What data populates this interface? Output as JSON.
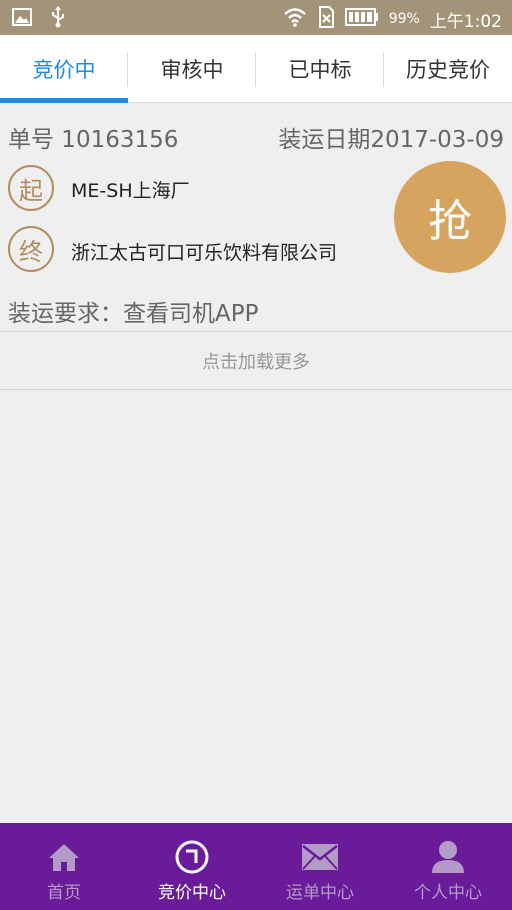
{
  "status": {
    "battery": "99%",
    "time": "上午1:02"
  },
  "tabs": [
    {
      "label": "竞价中"
    },
    {
      "label": "审核中"
    },
    {
      "label": "已中标"
    },
    {
      "label": "历史竞价"
    }
  ],
  "order": {
    "number": "单号 10163156",
    "date": "装运日期2017-03-09",
    "origin_badge": "起",
    "origin": "ME-SH上海厂",
    "dest_badge": "终",
    "destination": "浙江太古可口可乐饮料有限公司",
    "grab_label": "抢",
    "requirement": "装运要求：查看司机APP"
  },
  "load_more": "点击加载更多",
  "bottom_nav": [
    {
      "label": "首页",
      "icon": "home-icon"
    },
    {
      "label": "竞价中心",
      "icon": "bid-center-icon"
    },
    {
      "label": "运单中心",
      "icon": "mail-icon"
    },
    {
      "label": "个人中心",
      "icon": "user-icon"
    }
  ],
  "colors": {
    "status_bar": "#a39479",
    "accent": "#1e88e5",
    "gold": "#d6a45e",
    "nav_bg": "#6a1b9a"
  }
}
